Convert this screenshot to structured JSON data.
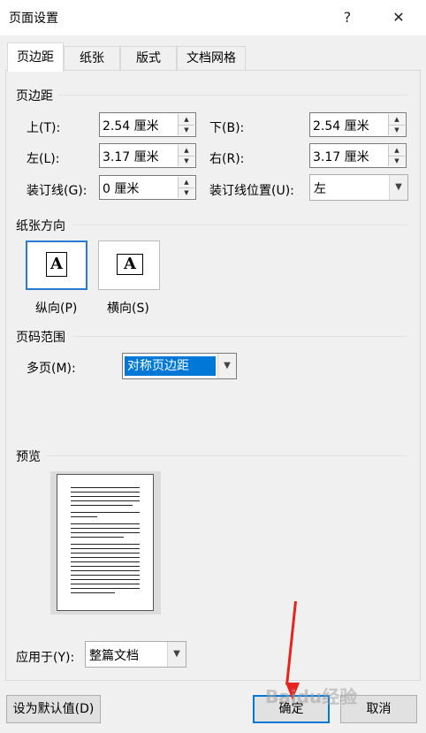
{
  "window": {
    "title": "页面设置",
    "help_glyph": "?",
    "close_glyph": "✕"
  },
  "tabs": [
    {
      "label": "页边距",
      "active": true
    },
    {
      "label": "纸张",
      "active": false
    },
    {
      "label": "版式",
      "active": false
    },
    {
      "label": "文档网格",
      "active": false
    }
  ],
  "margins": {
    "section_title": "页边距",
    "top": {
      "label": "上(T):",
      "value": "2.54 厘米"
    },
    "bottom": {
      "label": "下(B):",
      "value": "2.54 厘米"
    },
    "left": {
      "label": "左(L):",
      "value": "3.17 厘米"
    },
    "right": {
      "label": "右(R):",
      "value": "3.17 厘米"
    },
    "gutter": {
      "label": "装订线(G):",
      "value": "0 厘米"
    },
    "gutter_position": {
      "label": "装订线位置(U):",
      "value": "左"
    }
  },
  "orientation": {
    "section_title": "纸张方向",
    "portrait_label": "纵向(P)",
    "landscape_label": "横向(S)",
    "icon_letter": "A",
    "selected": "portrait"
  },
  "pages": {
    "section_title": "页码范围",
    "multiple_label": "多页(M):",
    "multiple_value": "对称页边距"
  },
  "preview": {
    "section_title": "预览",
    "apply_label": "应用于(Y):",
    "apply_value": "整篇文档"
  },
  "buttons": {
    "default": "设为默认值(D)",
    "ok": "确定",
    "cancel": "取消"
  },
  "colors": {
    "accent": "#0078d7",
    "selection": "#2a7bd1",
    "annotation_arrow": "#e8231e"
  },
  "icons": {
    "spin_up": "▲",
    "spin_down": "▼",
    "dropdown": "▼"
  },
  "watermark": "Baidu经验"
}
